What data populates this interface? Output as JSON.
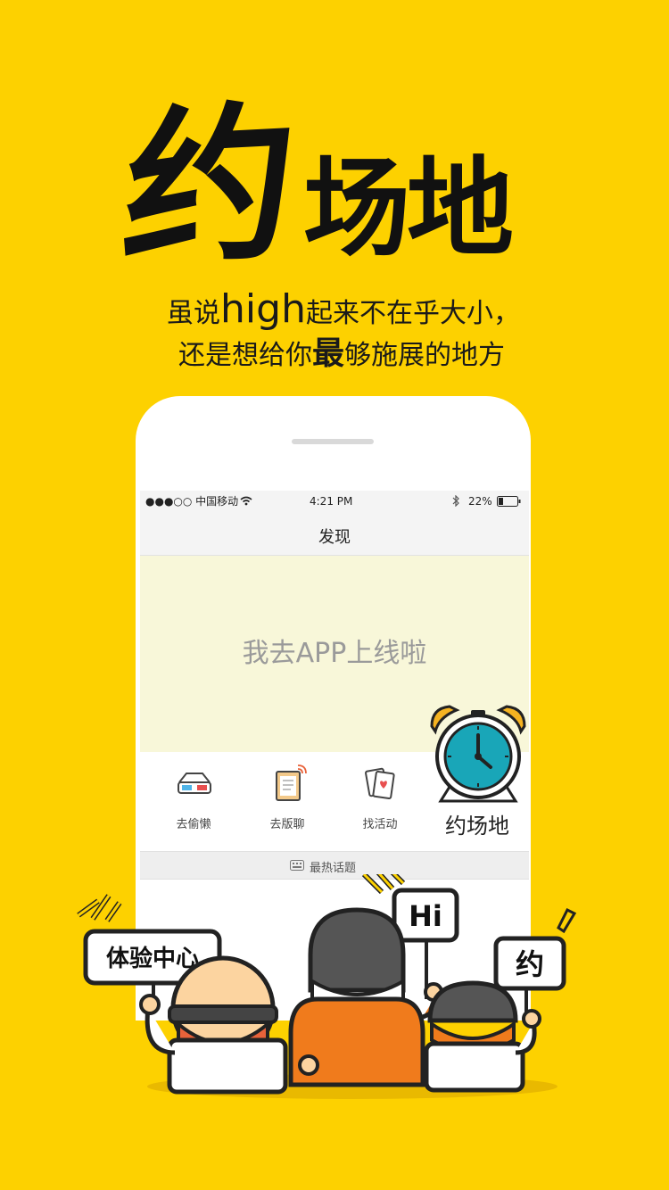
{
  "hero": {
    "title_first": "约",
    "title_rest": "场地",
    "slogan_line1_a": "虽说",
    "slogan_line1_b": "high",
    "slogan_line1_c": "起来不在乎大小，",
    "slogan_line2_a": "还是想给你",
    "slogan_line2_b": "最",
    "slogan_line2_c": "够施展的地方"
  },
  "status_bar": {
    "carrier": "●●●○○ 中国移动",
    "time": "4:21 PM",
    "battery": "22%"
  },
  "nav": {
    "title": "发现"
  },
  "banner": {
    "text": "我去APP上线啦"
  },
  "menu": {
    "items": [
      {
        "label": "去偷懒",
        "icon": "3d-glasses-icon"
      },
      {
        "label": "去版聊",
        "icon": "tablet-wifi-icon"
      },
      {
        "label": "找活动",
        "icon": "playing-cards-icon"
      },
      {
        "label": "约场地",
        "icon": "alarm-clock-icon"
      }
    ]
  },
  "section": {
    "label": "最热话题",
    "icon": "chat-keyboard-icon"
  },
  "characters": {
    "sign_left": "体验中心",
    "sign_middle": "Hi",
    "sign_right": "约"
  },
  "colors": {
    "background": "#FDD100",
    "banner": "#F8F7D9",
    "clock_face": "#19A6B8",
    "orange": "#F07B1C"
  }
}
